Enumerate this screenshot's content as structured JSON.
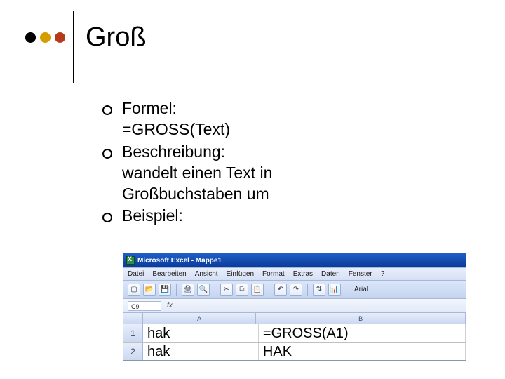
{
  "title": "Groß",
  "bullets": {
    "formel": {
      "label": "Formel:",
      "value": "=GROSS(Text)"
    },
    "beschreibung": {
      "label": "Beschreibung:",
      "value": "wandelt einen Text in Großbuchstaben um"
    },
    "beispiel": {
      "label": "Beispiel:"
    }
  },
  "excel": {
    "title": "Microsoft Excel - Mappe1",
    "menus": [
      "Datei",
      "Bearbeiten",
      "Ansicht",
      "Einfügen",
      "Format",
      "Extras",
      "Daten",
      "Fenster",
      "?"
    ],
    "font_label": "Arial",
    "cellref": "C9",
    "fx_label": "fx",
    "columns": [
      "A",
      "B"
    ],
    "rows": [
      {
        "num": "1",
        "a": "hak",
        "b": "=GROSS(A1)"
      },
      {
        "num": "2",
        "a": "hak",
        "b": "HAK"
      }
    ]
  }
}
